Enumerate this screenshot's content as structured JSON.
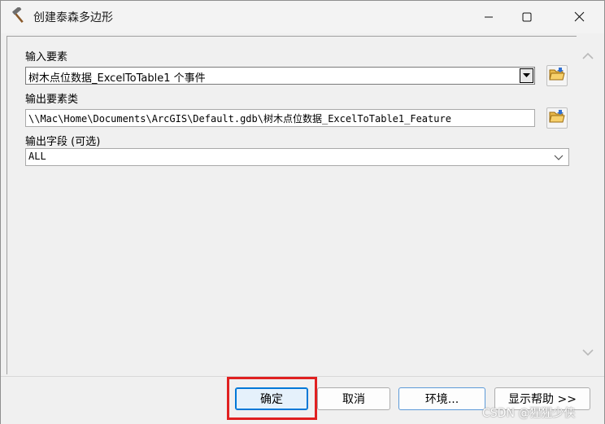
{
  "window": {
    "title": "创建泰森多边形",
    "icon": "hammer-icon",
    "controls": [
      "minimize-icon",
      "maximize-icon",
      "close-icon"
    ]
  },
  "form": {
    "input_features": {
      "label": "输入要素",
      "value": "树木点位数据_ExcelToTable1 个事件"
    },
    "output_feature_class": {
      "label": "输出要素类",
      "value": "\\\\Mac\\Home\\Documents\\ArcGIS\\Default.gdb\\树木点位数据_ExcelToTable1_Feature"
    },
    "output_fields": {
      "label": "输出字段 (可选)",
      "value": "ALL"
    }
  },
  "buttons": {
    "ok": "确定",
    "cancel": "取消",
    "environments": "环境...",
    "show_help": "显示帮助 >>"
  },
  "watermark": "CSDN @猩猩少侠",
  "colors": {
    "highlight": "#e02020",
    "focus_border": "#0078d7"
  }
}
